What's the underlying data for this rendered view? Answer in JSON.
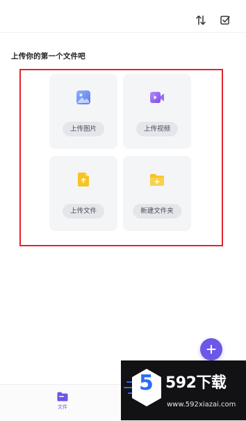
{
  "header": {
    "icons": [
      "sort-icon",
      "select-checkbox-icon"
    ]
  },
  "main": {
    "heading": "上传你的第一个文件吧",
    "actions": [
      {
        "label": "上传图片",
        "icon": "image-icon",
        "color": "#6f8ef5"
      },
      {
        "label": "上传视频",
        "icon": "video-icon",
        "color": "#8a5cf0"
      },
      {
        "label": "上传文件",
        "icon": "file-upload-icon",
        "color": "#f7c325"
      },
      {
        "label": "新建文件夹",
        "icon": "new-folder-icon",
        "color": "#f7c325"
      }
    ],
    "highlight_color": "#e3222b"
  },
  "fab": {
    "icon": "plus-icon",
    "color": "#6b57e8"
  },
  "bottom_nav": {
    "items": [
      {
        "label": "文件",
        "icon": "folder-icon"
      }
    ]
  },
  "watermark": {
    "badge_number": "5",
    "brand": "592下载",
    "url": "www.592xiazai.com"
  }
}
